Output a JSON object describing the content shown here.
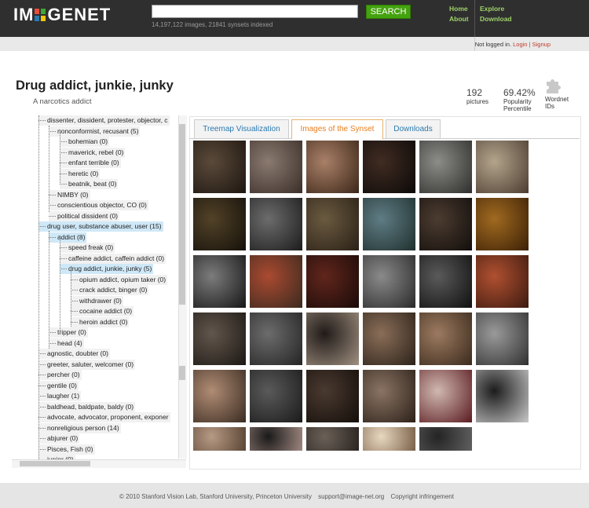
{
  "header": {
    "logo_text_left": "IM",
    "logo_text_right": "GENET",
    "logo_grid_colors": [
      "#e74c3c",
      "#3fa535",
      "#2a7ab0",
      "#f1c40f"
    ],
    "search_button": "SEARCH",
    "search_value": "",
    "stats": "14,197,122 images, 21841 synsets indexed",
    "nav": [
      "Home",
      "Explore",
      "About",
      "Download"
    ]
  },
  "login": {
    "status": "Not logged in.",
    "login_link": "Login",
    "separator": "|",
    "signup_link": "Signup"
  },
  "synset": {
    "title": "Drug addict, junkie, junky",
    "gloss": "A narcotics addict",
    "pictures_count": "192",
    "pictures_label": "pictures",
    "popularity_value": "69.42%",
    "popularity_label_1": "Popularity",
    "popularity_label_2": "Percentile",
    "wordnet_label_1": "Wordnet",
    "wordnet_label_2": "IDs"
  },
  "tree": [
    {
      "label": "dissenter, dissident, protester, objector, c",
      "depth": 2,
      "highlight": false
    },
    {
      "label": "nonconformist, recusant (5)",
      "depth": 3,
      "highlight": false
    },
    {
      "label": "bohemian (0)",
      "depth": 4,
      "highlight": false
    },
    {
      "label": "maverick, rebel (0)",
      "depth": 4,
      "highlight": false
    },
    {
      "label": "enfant terrible (0)",
      "depth": 4,
      "highlight": false
    },
    {
      "label": "heretic (0)",
      "depth": 4,
      "highlight": false
    },
    {
      "label": "beatnik, beat (0)",
      "depth": 4,
      "highlight": false
    },
    {
      "label": "NIMBY (0)",
      "depth": 3,
      "highlight": false
    },
    {
      "label": "conscientious objector, CO (0)",
      "depth": 3,
      "highlight": false
    },
    {
      "label": "political dissident (0)",
      "depth": 3,
      "highlight": false
    },
    {
      "label": "drug user, substance abuser, user (15)",
      "depth": 2,
      "highlight": true
    },
    {
      "label": "addict (8)",
      "depth": 3,
      "highlight": true
    },
    {
      "label": "speed freak (0)",
      "depth": 4,
      "highlight": false
    },
    {
      "label": "caffeine addict, caffein addict (0)",
      "depth": 4,
      "highlight": false
    },
    {
      "label": "drug addict, junkie, junky (5)",
      "depth": 4,
      "highlight": true
    },
    {
      "label": "opium addict, opium taker (0)",
      "depth": 5,
      "highlight": false
    },
    {
      "label": "crack addict, binger (0)",
      "depth": 5,
      "highlight": false
    },
    {
      "label": "withdrawer (0)",
      "depth": 5,
      "highlight": false
    },
    {
      "label": "cocaine addict (0)",
      "depth": 5,
      "highlight": false
    },
    {
      "label": "heroin addict (0)",
      "depth": 5,
      "highlight": false
    },
    {
      "label": "tripper (0)",
      "depth": 3,
      "highlight": false
    },
    {
      "label": "head (4)",
      "depth": 3,
      "highlight": false
    },
    {
      "label": "agnostic, doubter (0)",
      "depth": 2,
      "highlight": false
    },
    {
      "label": "greeter, saluter, welcomer (0)",
      "depth": 2,
      "highlight": false
    },
    {
      "label": "percher (0)",
      "depth": 2,
      "highlight": false
    },
    {
      "label": "gentile (0)",
      "depth": 2,
      "highlight": false
    },
    {
      "label": "laugher (1)",
      "depth": 2,
      "highlight": false
    },
    {
      "label": "baldhead, baldpate, baldy (0)",
      "depth": 2,
      "highlight": false
    },
    {
      "label": "advocate, advocator, proponent, exponer",
      "depth": 2,
      "highlight": false
    },
    {
      "label": "nonreligious person (14)",
      "depth": 2,
      "highlight": false
    },
    {
      "label": "abjurer (0)",
      "depth": 2,
      "highlight": false
    },
    {
      "label": "Pisces, Fish (0)",
      "depth": 2,
      "highlight": false
    },
    {
      "label": "junior (0)",
      "depth": 2,
      "highlight": false
    }
  ],
  "tabs": [
    {
      "label": "Treemap Visualization",
      "active": false
    },
    {
      "label": "Images of the Synset",
      "active": true
    },
    {
      "label": "Downloads",
      "active": false
    }
  ],
  "thumbnails": [
    {
      "a": "#5a4a3a",
      "b": "#1e1610"
    },
    {
      "a": "#8a7a70",
      "b": "#3a2e28"
    },
    {
      "a": "#a98068",
      "b": "#3b2618"
    },
    {
      "a": "#402c22",
      "b": "#0c0908"
    },
    {
      "a": "#8c8c88",
      "b": "#2e2e2c"
    },
    {
      "a": "#b4a48c",
      "b": "#4a3c30"
    },
    {
      "a": "#524228",
      "b": "#15110a"
    },
    {
      "a": "#6c6c6c",
      "b": "#1c1c1c"
    },
    {
      "a": "#6a5a40",
      "b": "#2a2016"
    },
    {
      "a": "#5f7c84",
      "b": "#20302e"
    },
    {
      "a": "#4c3c30",
      "b": "#120e0c"
    },
    {
      "a": "#a06a20",
      "b": "#3c2006"
    },
    {
      "a": "#7c7c7c",
      "b": "#161616"
    },
    {
      "a": "#aa4a30",
      "b": "#3a2a20"
    },
    {
      "a": "#60261c",
      "b": "#1a0a08"
    },
    {
      "a": "#8a8a8a",
      "b": "#2a2a2a"
    },
    {
      "a": "#5a5a5a",
      "b": "#101010"
    },
    {
      "a": "#b05030",
      "b": "#3c1a10"
    },
    {
      "a": "#62564c",
      "b": "#1c1814"
    },
    {
      "a": "#6c6c6c",
      "b": "#242424"
    },
    {
      "a": "#201a18",
      "b": "#a09080"
    },
    {
      "a": "#8a6e58",
      "b": "#2c221a"
    },
    {
      "a": "#9c7a60",
      "b": "#3a2a1c"
    },
    {
      "a": "#9a9a9a",
      "b": "#303030"
    },
    {
      "a": "#b08c74",
      "b": "#3a2c22"
    },
    {
      "a": "#5a5a5a",
      "b": "#1a1a1a"
    },
    {
      "a": "#4a3a30",
      "b": "#140e0a"
    },
    {
      "a": "#8a7464",
      "b": "#2c2018"
    },
    {
      "a": "#d0b8b0",
      "b": "#5a1a20"
    },
    {
      "a": "#1c1c1c",
      "b": "#c8c8c8"
    },
    {
      "a": "#b69a84",
      "b": "#5a4434"
    },
    {
      "a": "#1a1a1a",
      "b": "#a08880"
    },
    {
      "a": "#6a6058",
      "b": "#2a2420"
    },
    {
      "a": "#e8d8c0",
      "b": "#7a6048"
    },
    {
      "a": "#242424",
      "b": "#606060"
    }
  ],
  "footer": {
    "copyright": "© 2010 Stanford Vision Lab, Stanford University, Princeton University",
    "email": "support@image-net.org",
    "infringement": "Copyright infringement"
  }
}
